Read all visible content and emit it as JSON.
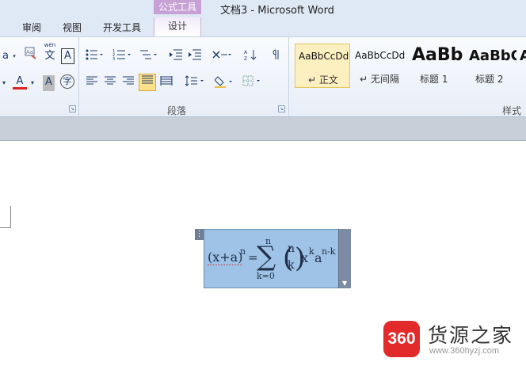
{
  "titlebar": {
    "context_tab_label": "公式工具",
    "document_title": "文档3 - Microsoft Word"
  },
  "tabs": [
    {
      "label": "审阅"
    },
    {
      "label": "视图"
    },
    {
      "label": "开发工具"
    },
    {
      "label": "设计",
      "active": true
    }
  ],
  "ribbon": {
    "groups": {
      "paragraph": {
        "label": "段落"
      },
      "styles": {
        "label": "样式"
      }
    },
    "font_buttons": {
      "font_size_partial": "a",
      "phonetic": "wén",
      "phonetic_char": "文",
      "char_border": "A",
      "font_color": "A",
      "char_shading": "A",
      "enclose_char": "字"
    },
    "styles": [
      {
        "sample": "AaBbCcDd",
        "name": "↵ 正文",
        "selected": true
      },
      {
        "sample": "AaBbCcDd",
        "name": "↵ 无间隔"
      },
      {
        "sample": "AaBb",
        "name": "标题 1"
      },
      {
        "sample": "AaBbC",
        "name": "标题 2"
      },
      {
        "sample": "A",
        "name": ""
      }
    ]
  },
  "equation": {
    "lhs": "(x+a)",
    "lhs_sup": "n",
    "equals": "=",
    "sum_symbol": "∑",
    "sum_upper": "n",
    "sum_lower": "k=0",
    "binom_open": "(",
    "binom_top": "n",
    "binom_bottom": "k",
    "binom_close": ")",
    "x": "x",
    "x_sup": "k",
    "a": "a",
    "a_sup": "n-k"
  },
  "watermark": {
    "logo_text": "360",
    "name": "货源之家",
    "url": "www.360hyzj.com"
  },
  "colors": {
    "context_tab": "#c7a0d6",
    "equation_highlight": "#9fc3e6",
    "watermark_red": "#e22a2a"
  }
}
